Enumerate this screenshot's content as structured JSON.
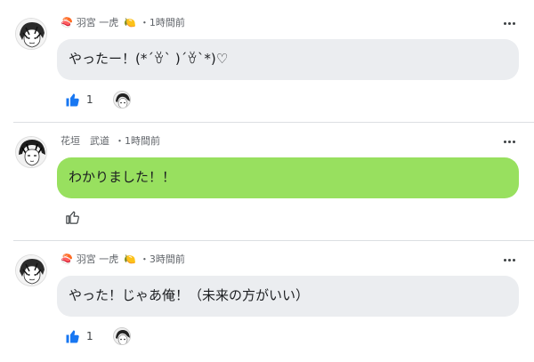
{
  "comments": [
    {
      "badge_left": "🍣",
      "author": "羽宮 一虎",
      "badge_right": "🍋",
      "separator": "・",
      "time": "1時間前",
      "text": "やったー！(*´ꈊ` )´ꈊ`*)♡",
      "bubble_color": "#ebedf0",
      "likes": "1",
      "liked": true,
      "has_reactor": true
    },
    {
      "badge_left": "",
      "author": "花垣　武道",
      "badge_right": "",
      "separator": "・",
      "time": "1時間前",
      "text": "わかりました！！",
      "bubble_color": "#98e05f",
      "likes": "",
      "liked": false,
      "has_reactor": false
    },
    {
      "badge_left": "🍣",
      "author": "羽宮 一虎",
      "badge_right": "🍋",
      "separator": "・",
      "time": "3時間前",
      "text": "やった！じゃあ俺！（未来の方がいい）",
      "bubble_color": "#ebedf0",
      "likes": "1",
      "liked": true,
      "has_reactor": true
    }
  ],
  "icons": {
    "more": "more-options-icon",
    "like_filled": "thumbs-up-filled-icon",
    "like_outline": "thumbs-up-outline-icon"
  },
  "colors": {
    "like_blue": "#1877f2",
    "bubble_gray": "#ebedf0",
    "bubble_green": "#98e05f",
    "divider": "#dcdfe3"
  }
}
